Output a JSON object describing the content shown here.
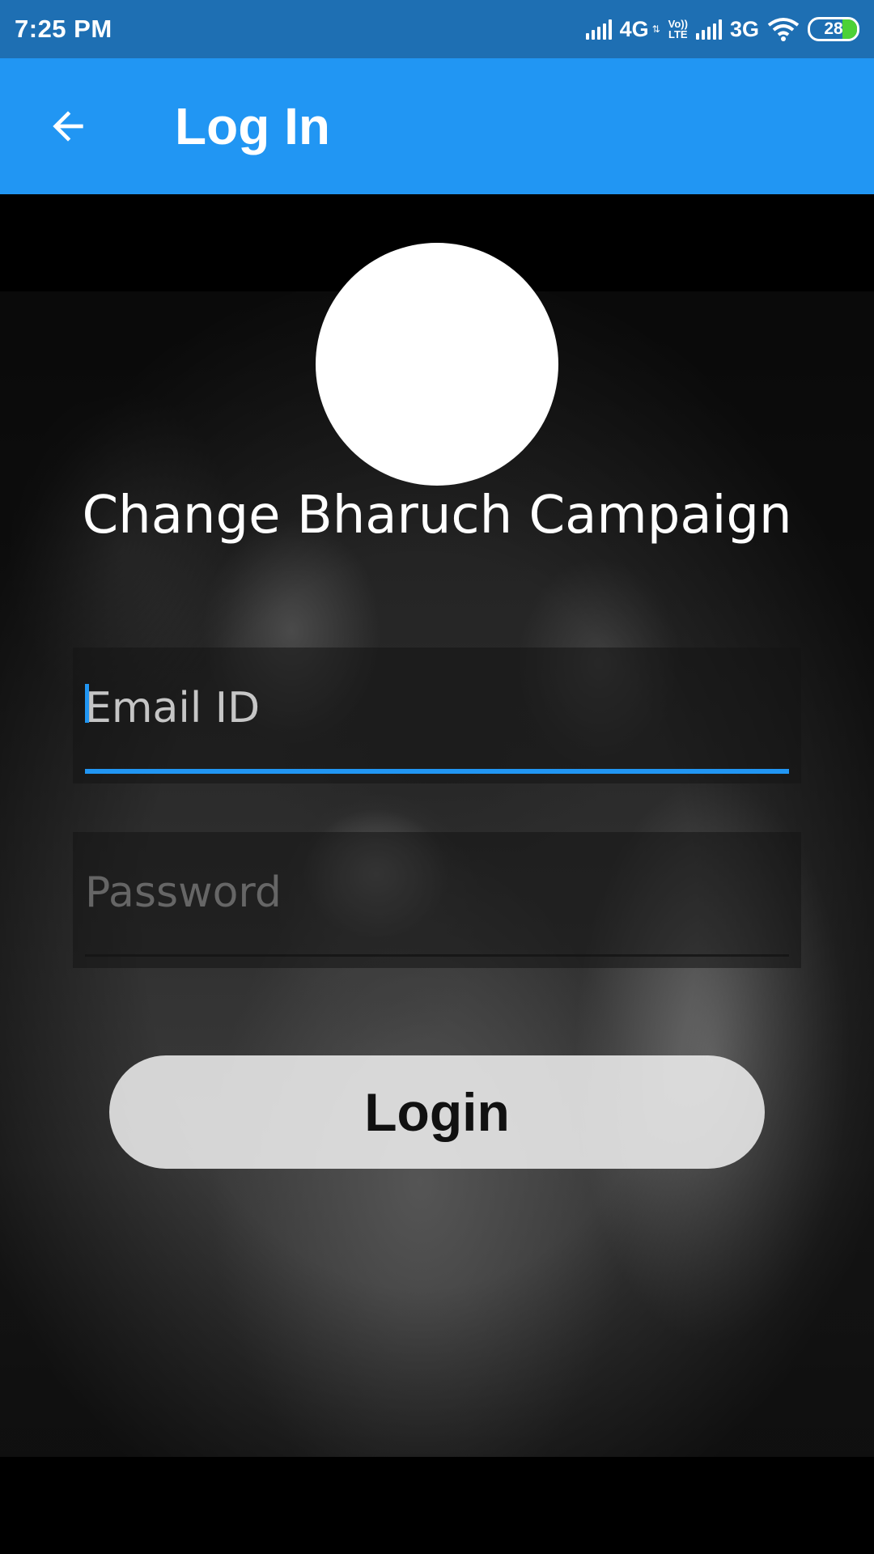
{
  "status_bar": {
    "time": "7:25 PM",
    "network_1": "4G",
    "volte_1": "Vo))",
    "volte_2": "LTE",
    "network_2": "3G",
    "battery": "28"
  },
  "app_bar": {
    "title": "Log In",
    "back_icon": "arrow-back-icon"
  },
  "main": {
    "org_name": "Change Bharuch Campaign",
    "email_field": {
      "placeholder": "Email ID",
      "value": ""
    },
    "password_field": {
      "placeholder": "Password",
      "value": ""
    },
    "login_button": "Login"
  },
  "colors": {
    "status_bar": "#1e6fb3",
    "app_bar": "#2196f3",
    "accent": "#2196f3",
    "background": "#000000"
  }
}
